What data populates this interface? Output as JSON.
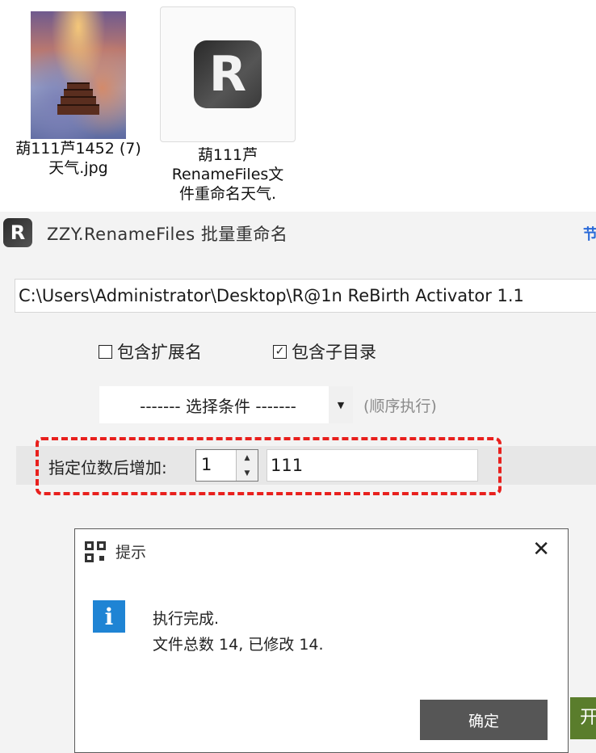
{
  "desktop": {
    "files": [
      {
        "line1": "葫111芦1452 (7)",
        "line2": "天气.jpg",
        "line3": ""
      },
      {
        "line1": "葫111芦",
        "line2": "RenameFiles文",
        "line3": "件重命名天气."
      }
    ],
    "app_icon_letter": "R"
  },
  "window": {
    "logo_letter": "R",
    "title": "ZZY.RenameFiles 批量重命名",
    "edge_glyph": "节",
    "path": "C:\\Users\\Administrator\\Desktop\\R@1n ReBirth Activator 1.1",
    "include_ext": {
      "label": "包含扩展名",
      "checked": false,
      "mark": ""
    },
    "include_sub": {
      "label": "包含子目录",
      "checked": true,
      "mark": "✓"
    },
    "condition": {
      "selected": "------- 选择条件 -------",
      "arrow": "▼",
      "hint": "(顺序执行)"
    },
    "rule": {
      "label": "指定位数后增加:",
      "position": "1",
      "text": "111",
      "up": "▲",
      "down": "▼"
    },
    "start_button_edge": "开"
  },
  "dialog": {
    "title": "提示",
    "close": "✕",
    "info_glyph": "i",
    "line1": "执行完成.",
    "line2": "文件总数 14, 已修改 14.",
    "ok": "确定"
  },
  "colors": {
    "highlight": "#e8201d",
    "info_blue": "#1f84d4",
    "ok_button": "#565656",
    "start_green": "#5a7d2c"
  }
}
